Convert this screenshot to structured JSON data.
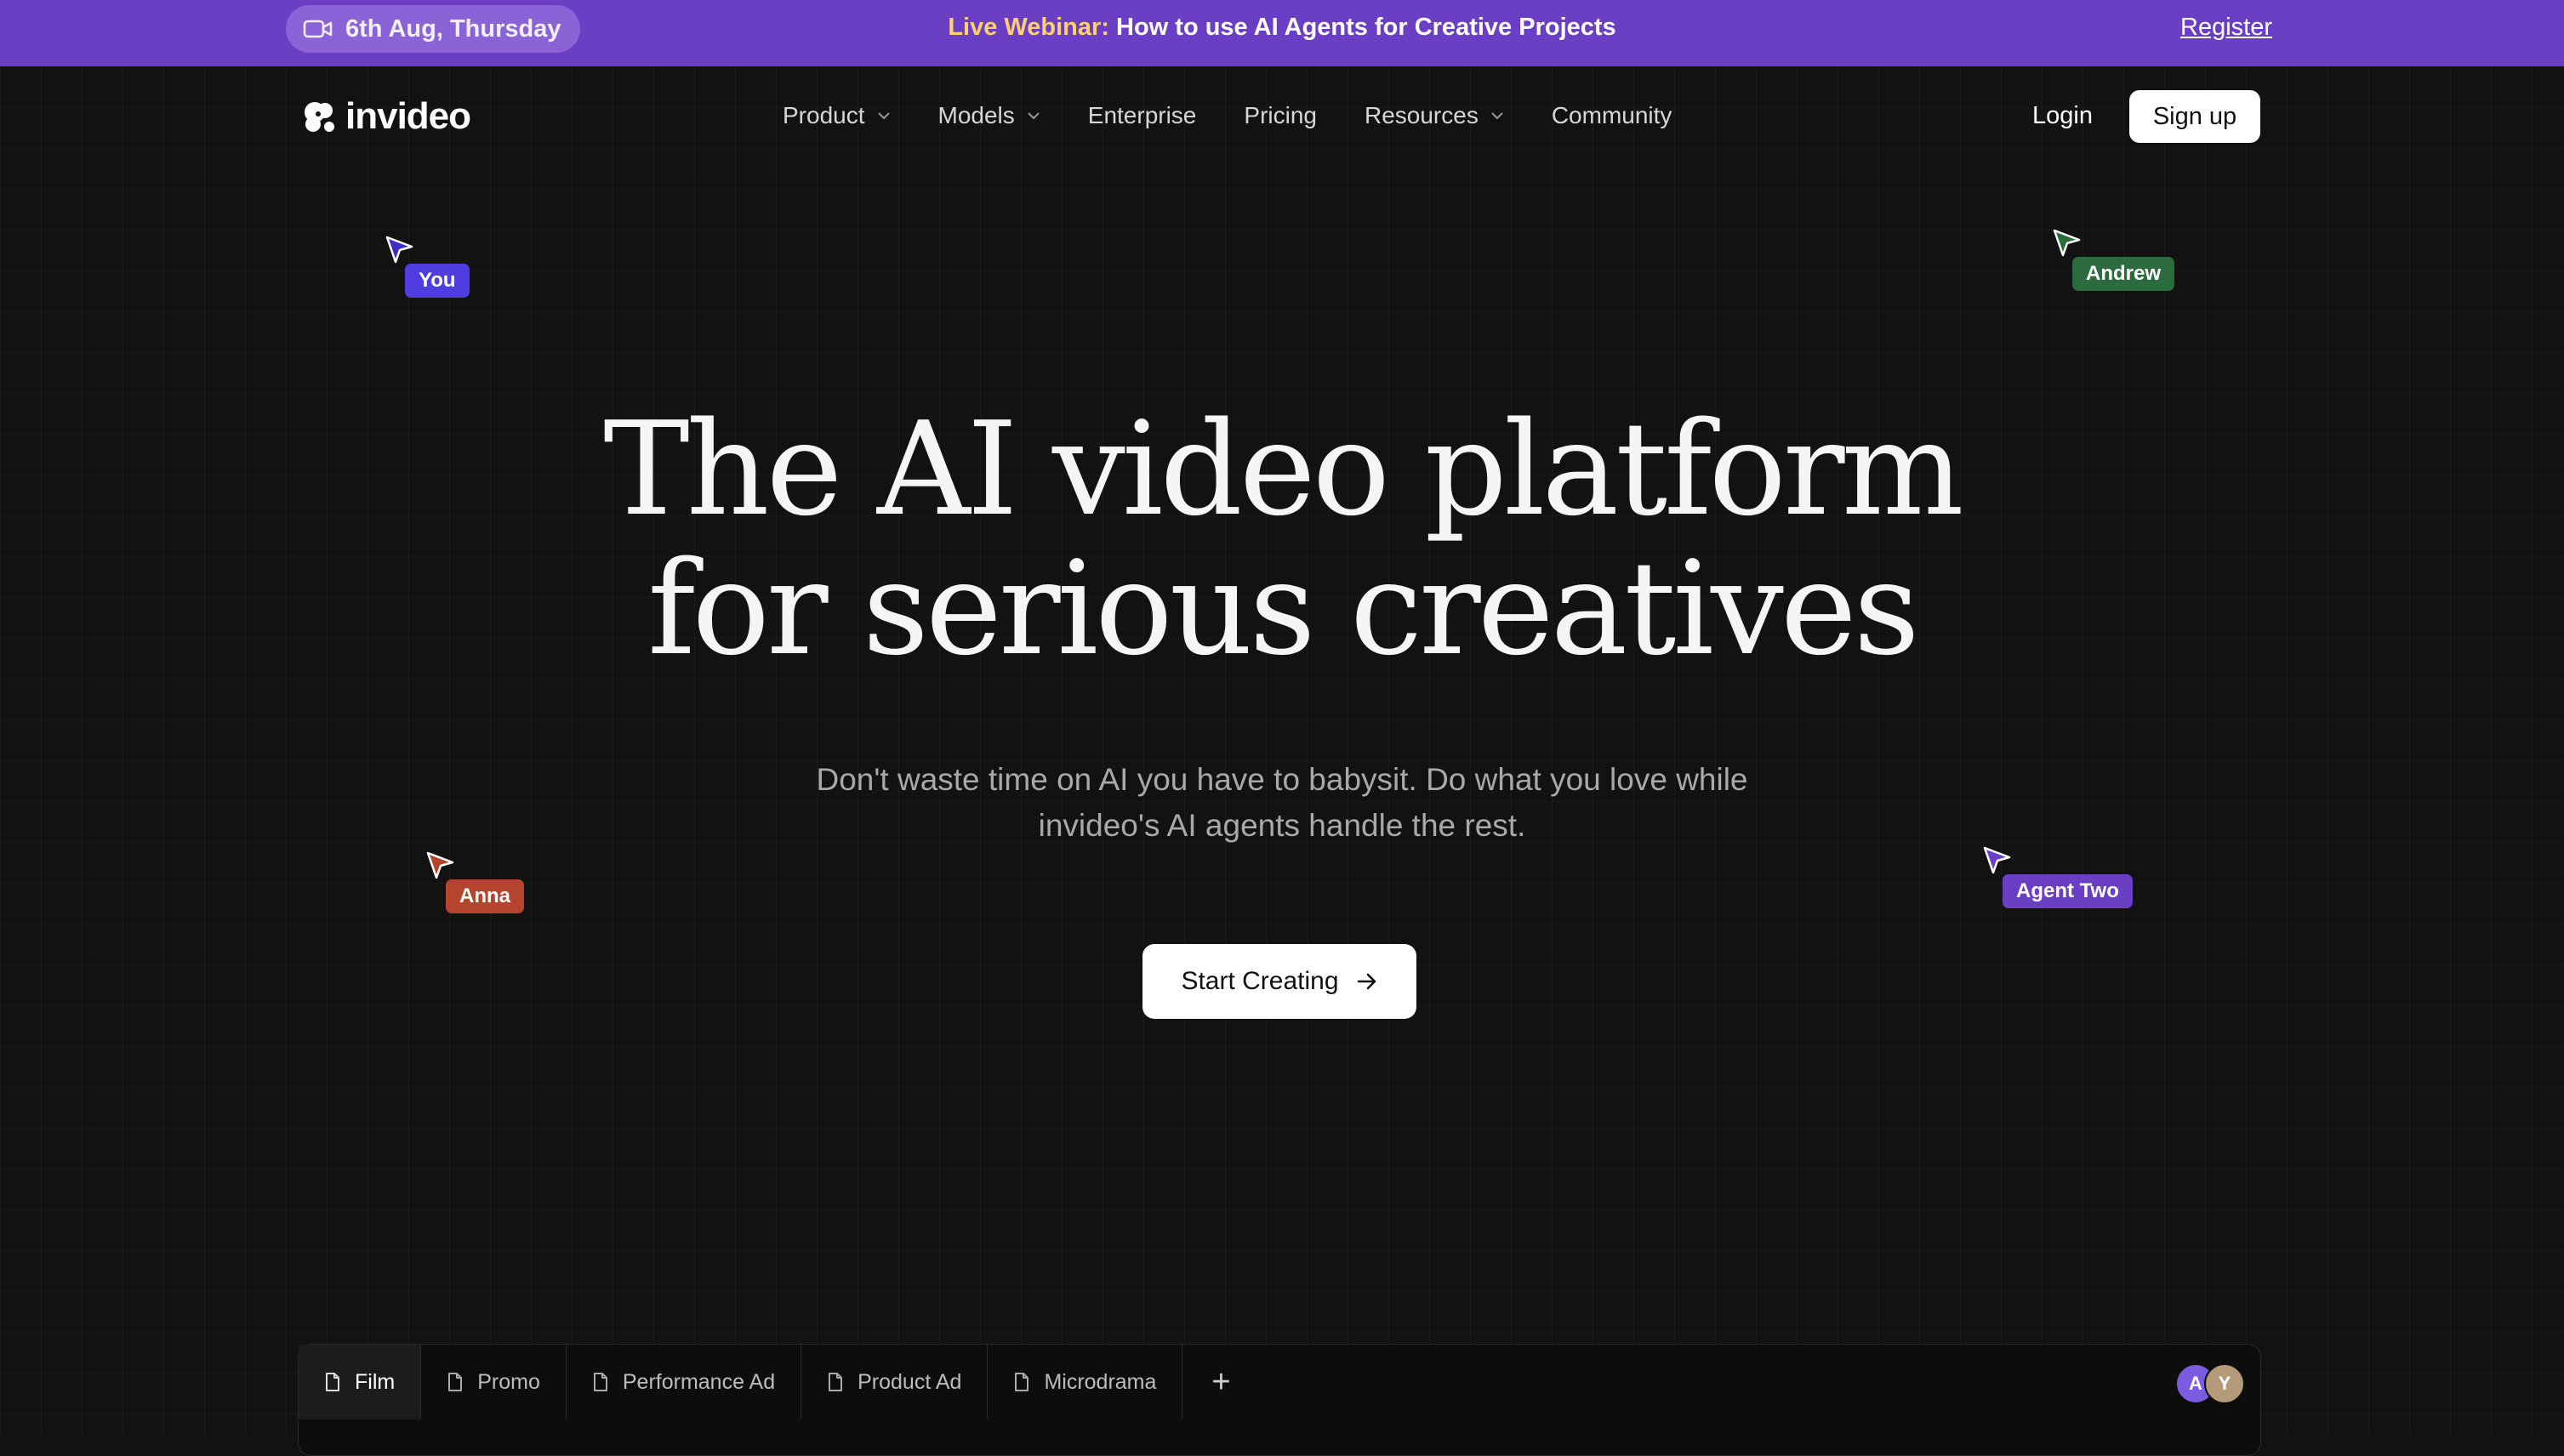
{
  "banner": {
    "date": "6th Aug, Thursday",
    "highlight": "Live Webinar:",
    "text": "How to use AI Agents for Creative Projects",
    "register": "Register"
  },
  "nav": {
    "logo": "invideo",
    "items": [
      {
        "label": "Product",
        "dropdown": true
      },
      {
        "label": "Models",
        "dropdown": true
      },
      {
        "label": "Enterprise",
        "dropdown": false
      },
      {
        "label": "Pricing",
        "dropdown": false
      },
      {
        "label": "Resources",
        "dropdown": true
      },
      {
        "label": "Community",
        "dropdown": false
      }
    ],
    "login": "Login",
    "signup": "Sign up"
  },
  "cursors": [
    {
      "name": "You",
      "color": "#4f3de0"
    },
    {
      "name": "Andrew",
      "color": "#2c6b3e"
    },
    {
      "name": "Anna",
      "color": "#b4442d"
    },
    {
      "name": "Agent Two",
      "color": "#6b3fc4"
    }
  ],
  "hero": {
    "line1": "The AI video platform",
    "line2": "for serious creatives",
    "sub1": "Don't waste time on AI you have to babysit. Do what you love while",
    "sub2": "invideo's AI agents handle the rest.",
    "cta": "Start Creating"
  },
  "tabs": [
    {
      "label": "Film",
      "active": true
    },
    {
      "label": "Promo",
      "active": false
    },
    {
      "label": "Performance Ad",
      "active": false
    },
    {
      "label": "Product Ad",
      "active": false
    },
    {
      "label": "Microdrama",
      "active": false
    }
  ],
  "tabs_plus": "+",
  "avatars": [
    {
      "letter": "A",
      "color": "#7b5be0"
    },
    {
      "letter": "Y",
      "color": "#b59a7a"
    }
  ]
}
